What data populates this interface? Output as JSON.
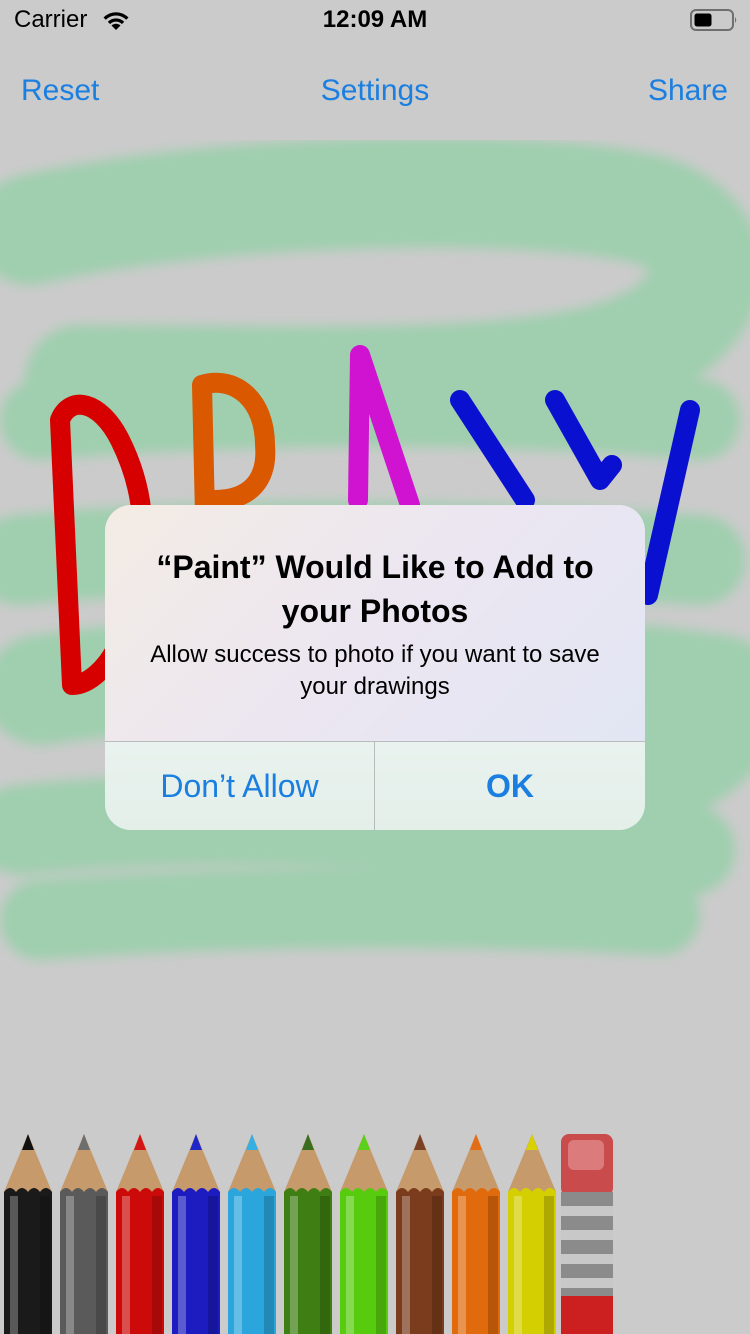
{
  "status_bar": {
    "carrier": "Carrier",
    "time": "12:09 AM"
  },
  "nav": {
    "reset": "Reset",
    "title": "Settings",
    "share": "Share"
  },
  "colors": {
    "accent": "#1a7fe0",
    "canvas_green": "#9fcfae",
    "stroke_red": "#d60000",
    "stroke_orange": "#d95800",
    "stroke_magenta": "#d013d0",
    "stroke_blue": "#0a10cf"
  },
  "alert": {
    "title": "“Paint” Would Like to Add to your Photos",
    "message": "Allow success to photo if you want to save your drawings",
    "deny_label": "Don’t Allow",
    "ok_label": "OK"
  },
  "tray": {
    "pencils": [
      {
        "name": "black",
        "color": "#1a1a1a",
        "tip": "#111111"
      },
      {
        "name": "gray",
        "color": "#5a5a5a",
        "tip": "#6e6e6e"
      },
      {
        "name": "red",
        "color": "#cc0a0a",
        "tip": "#d41515"
      },
      {
        "name": "blue",
        "color": "#1c1cc0",
        "tip": "#1f27c9"
      },
      {
        "name": "light-blue",
        "color": "#2aa6dd",
        "tip": "#36b0e2"
      },
      {
        "name": "dark-green",
        "color": "#3f7e12",
        "tip": "#3b6d1e"
      },
      {
        "name": "green",
        "color": "#57cc0e",
        "tip": "#5bd11a"
      },
      {
        "name": "brown",
        "color": "#7a3c1c",
        "tip": "#7b4124"
      },
      {
        "name": "orange",
        "color": "#e06a0c",
        "tip": "#e26d15"
      },
      {
        "name": "yellow",
        "color": "#d4cf00",
        "tip": "#d8d200"
      }
    ],
    "eraser": "eraser-icon"
  }
}
